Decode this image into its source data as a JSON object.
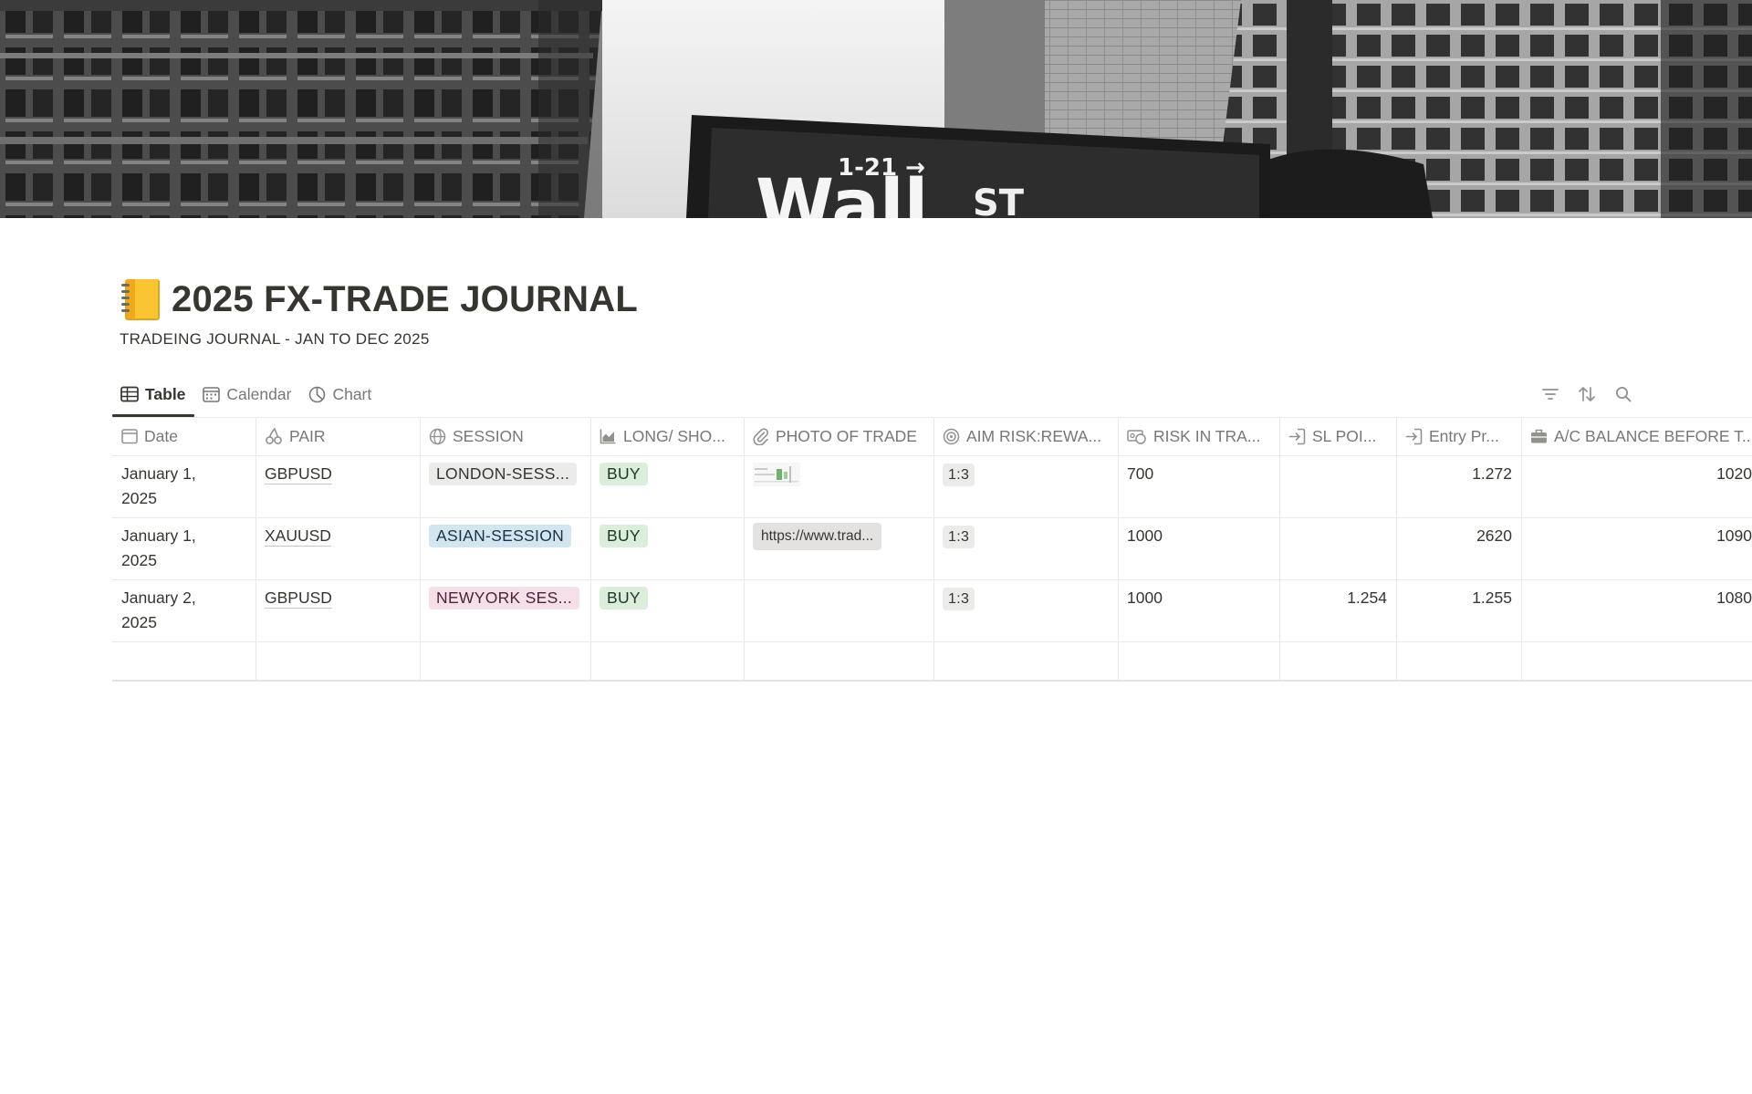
{
  "page": {
    "title": "2025 FX-TRADE JOURNAL",
    "subtitle": "TRADEING JOURNAL - JAN TO DEC 2025",
    "icon": "notebook-emoji",
    "cover": "wall-street-sign-photo"
  },
  "views": [
    {
      "label": "Table",
      "icon": "table-icon",
      "active": true
    },
    {
      "label": "Calendar",
      "icon": "calendar-icon",
      "active": false
    },
    {
      "label": "Chart",
      "icon": "chart-icon",
      "active": false
    }
  ],
  "toolbar": [
    "filter-icon",
    "sort-icon",
    "search-icon"
  ],
  "columns": [
    {
      "label": "Date",
      "icon": "calendar-icon"
    },
    {
      "label": "PAIR",
      "icon": "cherries-icon"
    },
    {
      "label": "SESSION",
      "icon": "globe-icon"
    },
    {
      "label": "LONG/ SHO...",
      "icon": "chart-icon"
    },
    {
      "label": "PHOTO OF TRADE",
      "icon": "paperclip-icon"
    },
    {
      "label": "AIM RISK:REWA...",
      "icon": "target-icon"
    },
    {
      "label": "RISK IN TRA...",
      "icon": "money-icon"
    },
    {
      "label": "SL POI...",
      "icon": "sign-in-icon"
    },
    {
      "label": "Entry Pr...",
      "icon": "sign-in-icon"
    },
    {
      "label": "A/C BALANCE BEFORE T...",
      "icon": "briefcase-icon"
    }
  ],
  "rows": [
    {
      "date_line1": "January 1,",
      "date_line2": "2025",
      "pair": "GBPUSD",
      "session": "LONDON-SESS...",
      "session_color": "gray",
      "direction": "BUY",
      "photo": "trade-screenshot-thumbnail",
      "photo_link": "",
      "aim_rr": "1:3",
      "risk": "700",
      "sl": "",
      "entry": "1.272",
      "balance": "1020"
    },
    {
      "date_line1": "January 1,",
      "date_line2": "2025",
      "pair": "XAUUSD",
      "session": "ASIAN-SESSION",
      "session_color": "blue",
      "direction": "BUY",
      "photo": "",
      "photo_link": "https://www.trad...",
      "aim_rr": "1:3",
      "risk": "1000",
      "sl": "",
      "entry": "2620",
      "balance": "1090"
    },
    {
      "date_line1": "January 2,",
      "date_line2": "2025",
      "pair": "GBPUSD",
      "session": "NEWYORK SES...",
      "session_color": "pink",
      "direction": "BUY",
      "photo": "",
      "photo_link": "",
      "aim_rr": "1:3",
      "risk": "1000",
      "sl": "1.254",
      "entry": "1.255",
      "balance": "1080"
    }
  ]
}
